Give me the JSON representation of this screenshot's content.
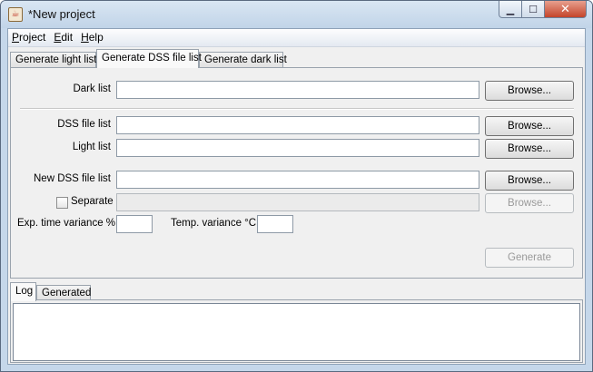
{
  "window": {
    "title": "*New project"
  },
  "menu": {
    "items": [
      {
        "label": "Project",
        "accel": "P",
        "rest": "roject"
      },
      {
        "label": "Edit",
        "accel": "E",
        "rest": "dit"
      },
      {
        "label": "Help",
        "accel": "H",
        "rest": "elp"
      }
    ]
  },
  "tabs": [
    {
      "label": "Generate light list",
      "active": false
    },
    {
      "label": "Generate DSS file list",
      "active": true
    },
    {
      "label": "Generate dark list",
      "active": false
    }
  ],
  "form": {
    "dark_list": {
      "label": "Dark list",
      "value": "",
      "button": "Browse..."
    },
    "dss_file_list": {
      "label": "DSS file list",
      "value": "",
      "button": "Browse..."
    },
    "light_list": {
      "label": "Light list",
      "value": "",
      "button": "Browse..."
    },
    "new_dss_file_list": {
      "label": "New DSS file list",
      "value": "",
      "button": "Browse..."
    },
    "separate": {
      "label": "Separate",
      "checked": false,
      "value": "",
      "button": "Browse..."
    },
    "exp_time_variance": {
      "label": "Exp. time variance %",
      "value": ""
    },
    "temp_variance": {
      "label": "Temp. variance °C",
      "value": ""
    },
    "generate_button": "Generate"
  },
  "log_tabs": [
    {
      "label": "Log",
      "active": true
    },
    {
      "label": "Generated",
      "active": false
    }
  ],
  "log": {
    "content": ""
  }
}
